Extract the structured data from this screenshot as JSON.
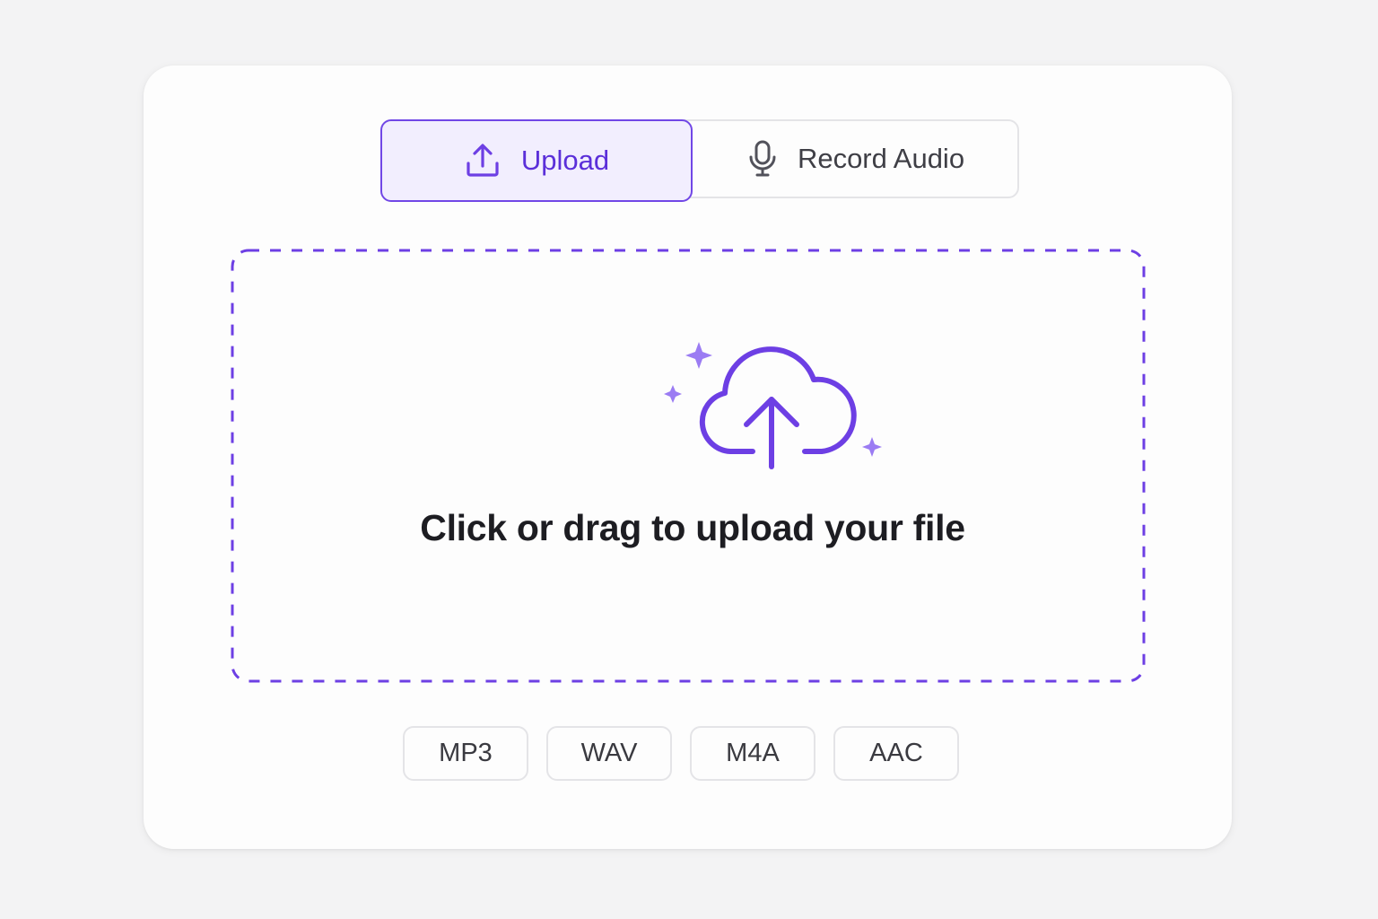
{
  "tabs": {
    "upload": {
      "label": "Upload",
      "icon": "upload-icon",
      "active": true
    },
    "record": {
      "label": "Record Audio",
      "icon": "microphone-icon",
      "active": false
    }
  },
  "dropzone": {
    "icon": "cloud-upload-icon",
    "text": "Click or drag to upload your file"
  },
  "formats": [
    "MP3",
    "WAV",
    "M4A",
    "AAC"
  ],
  "colors": {
    "accent": "#6d3fe4",
    "accent_light": "#9b7cf3",
    "active_tab_bg": "#f2eefe",
    "border": "#e4e4e7",
    "text_dark": "#1d1d22"
  }
}
